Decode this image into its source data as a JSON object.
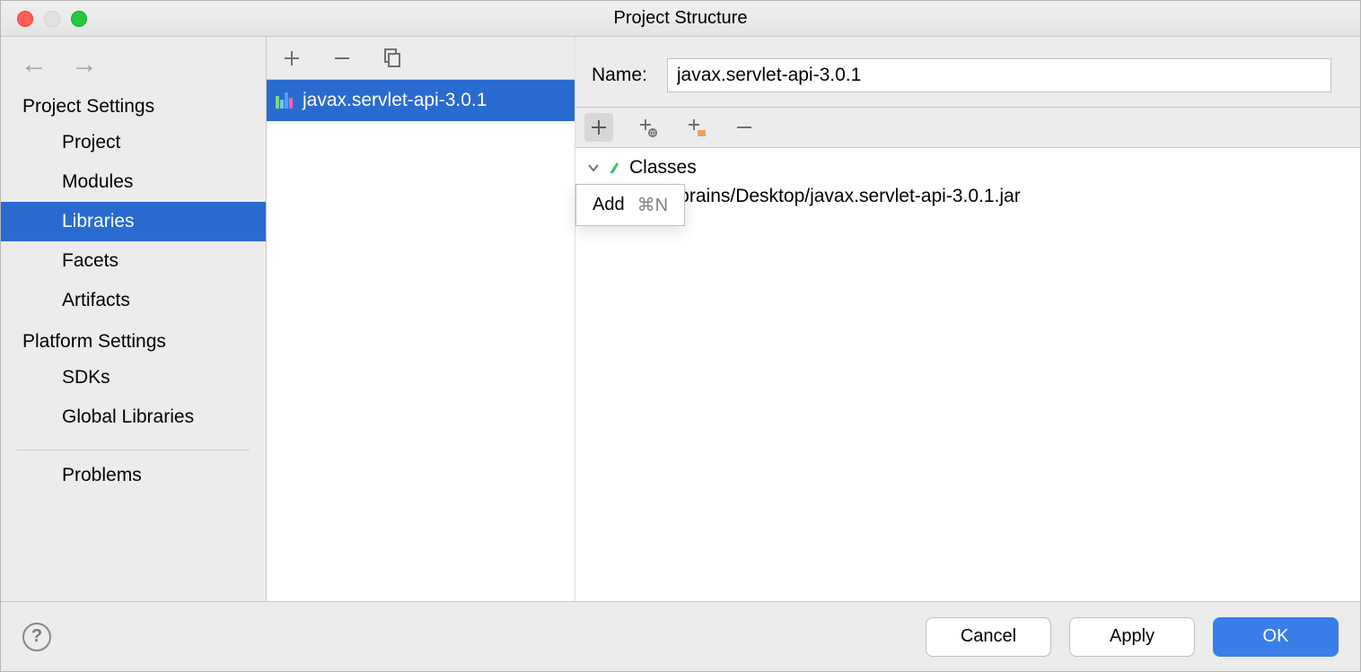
{
  "window": {
    "title": "Project Structure"
  },
  "sidebar": {
    "groupA": "Project Settings",
    "items": [
      "Project",
      "Modules",
      "Libraries",
      "Facets",
      "Artifacts"
    ],
    "selectedIndex": 2,
    "groupB": "Platform Settings",
    "itemsB": [
      "SDKs",
      "Global Libraries"
    ],
    "problems": "Problems"
  },
  "library_list": {
    "items": [
      "javax.servlet-api-3.0.1"
    ],
    "selectedIndex": 0
  },
  "detail": {
    "name_label": "Name:",
    "name_value": "javax.servlet-api-3.0.1",
    "tree_root": "Classes",
    "tree_child": "ers/jetbrains/Desktop/javax.servlet-api-3.0.1.jar"
  },
  "popup": {
    "label": "Add",
    "shortcut": "⌘N"
  },
  "footer": {
    "cancel": "Cancel",
    "apply": "Apply",
    "ok": "OK"
  }
}
